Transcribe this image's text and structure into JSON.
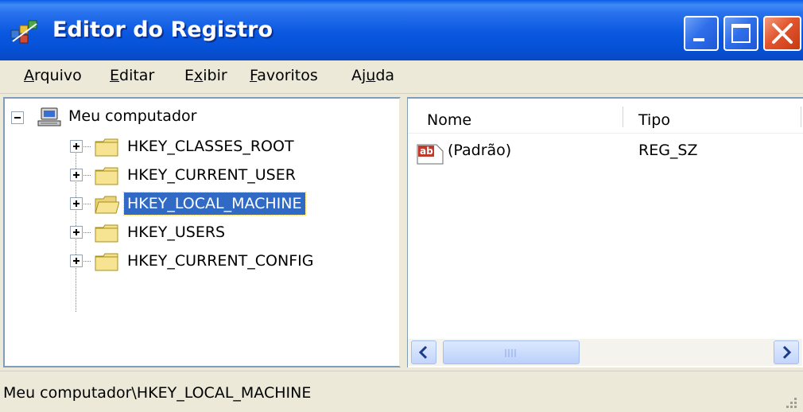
{
  "window": {
    "title": "Editor do Registro",
    "app_icon": "regedit-icon",
    "controls": {
      "minimize": "minimize-icon",
      "maximize": "maximize-icon",
      "close": "close-icon"
    }
  },
  "menu": {
    "items": [
      "Arquivo",
      "Editar",
      "Exibir",
      "Favoritos",
      "Ajuda"
    ],
    "mnemonics": [
      "A",
      "E",
      "x",
      "F",
      "u"
    ]
  },
  "tree": {
    "root": {
      "label": "Meu computador",
      "icon": "computer-icon",
      "expanded": true
    },
    "items": [
      {
        "label": "HKEY_CLASSES_ROOT",
        "icon": "folder-closed-icon",
        "selected": false
      },
      {
        "label": "HKEY_CURRENT_USER",
        "icon": "folder-closed-icon",
        "selected": false
      },
      {
        "label": "HKEY_LOCAL_MACHINE",
        "icon": "folder-open-icon",
        "selected": true
      },
      {
        "label": "HKEY_USERS",
        "icon": "folder-closed-icon",
        "selected": false
      },
      {
        "label": "HKEY_CURRENT_CONFIG",
        "icon": "folder-closed-icon",
        "selected": false
      }
    ]
  },
  "list": {
    "columns": [
      "Nome",
      "Tipo"
    ],
    "rows": [
      {
        "name": "(Padrão)",
        "type": "REG_SZ",
        "icon": "string-value-icon"
      }
    ]
  },
  "status": {
    "path": "Meu computador\\HKEY_LOCAL_MACHINE"
  },
  "colors": {
    "titlebar": "#0a58e0",
    "selection": "#316ac5",
    "face": "#ece9d8",
    "close_button": "#e2552e"
  }
}
